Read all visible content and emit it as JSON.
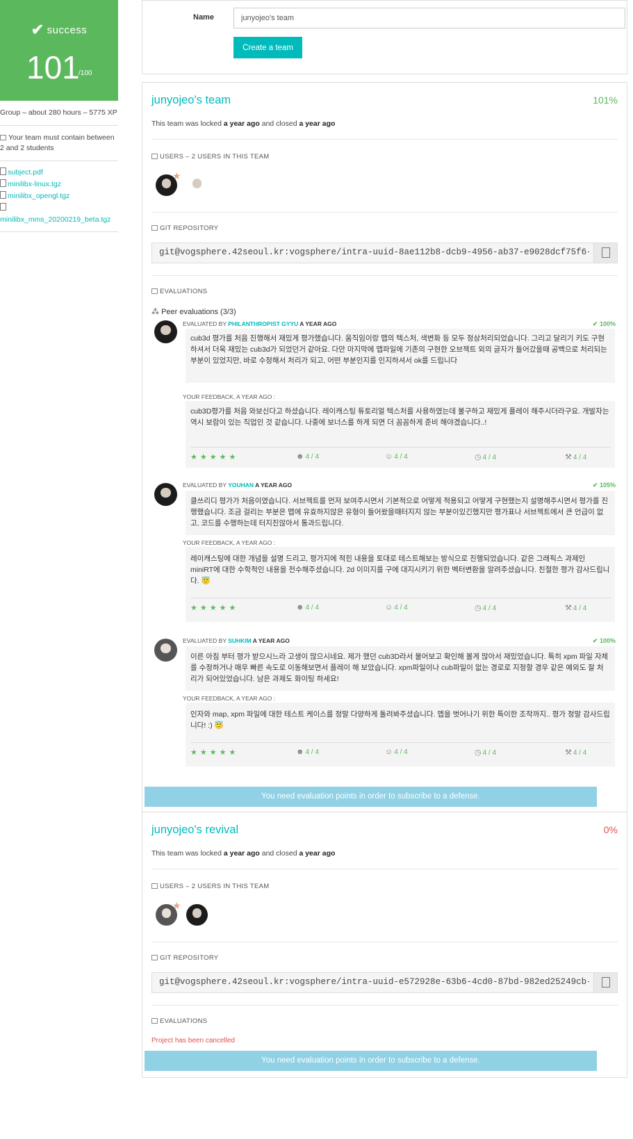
{
  "sidebar": {
    "status": "success",
    "score": "101",
    "score_max": "/100",
    "group_info": "Group – about 280 hours – 5775 XP",
    "team_rule": "Your team must contain between 2 and 2 students",
    "files": [
      "subject.pdf",
      "minilibx-linux.tgz",
      "minilibx_opengl.tgz",
      "minilibx_mms_20200219_beta.tgz"
    ]
  },
  "form": {
    "label": "Name",
    "input_value": "junyojeo's team",
    "button": "Create a team"
  },
  "team1": {
    "name": "junyojeo's team",
    "pct": "101%",
    "lock_prefix": "This team was locked ",
    "lock_ago1": "a year ago",
    "lock_mid": " and closed ",
    "lock_ago2": "a year ago",
    "users_header": "USERS – 2 USERS IN THIS TEAM",
    "git_header": "GIT REPOSITORY",
    "git_url": "git@vogsphere.42seoul.kr:vogsphere/intra-uuid-8ae112b8-dcb9-4956-ab37-e9028dcf75f6-",
    "eval_header": "EVALUATIONS",
    "peer_title": "Peer evaluations (3/3)",
    "evaluations": [
      {
        "by_prefix": "EVALUATED BY ",
        "evaluator": "PHILANTHROPIST GYYU",
        "ago": " A YEAR AGO",
        "pct": "100%",
        "comment": "cub3d 평가를 처음 진행해서 재밌게 평가했습니다. 움직임이랑 맵의 텍스처, 색변화 등 모두 정상처리되었습니다. 그리고 달리기 키도 구현하셔서 더욱 재밌는 cub3d가 되었던거 같아요. 다만 마지막에 맵파일에 기존의 구현한 오브젝트 외의 글자가 들어갔을때 공백으로 처리되는 부분이 있었지만, 바로 수정해서 처리가 되고, 어떤 부분인지를 인지하셔서 ok를 드립니다",
        "feedback_label": "YOUR FEEDBACK, A YEAR AGO :",
        "feedback": "cub3D평가를 처음 와보신다고 하셨습니다. 레이캐스팅 튜토리얼 텍스처를 사용하였는데 불구하고 재밌게 플레이 해주시더라구요. 개발자는 역시 보람이 있는 직업인 것 같습니다. 나중에 보너스를 하게 되면 더 꼼꼼하게 준비 해야겠습니다..!",
        "ratings": [
          "4 / 4",
          "4 / 4",
          "4 / 4",
          "4 / 4"
        ]
      },
      {
        "by_prefix": "EVALUATED BY ",
        "evaluator": "YOUHAN",
        "ago": " A YEAR AGO",
        "pct": "105%",
        "comment": "클쓰리디 평가가 처음이였습니다. 서브젝트를 먼저 보여주시면서 기본적으로 어떻게 적용되고 어떻게 구현했는지 설명해주시면서 평가를 진행했습니다. 조금 걸리는 부분은 맵에 유효하지않은 유형이 들어왔을때터지지 않는 부분이있긴했지만 평가표나 서브젝트에서 큰 언급이 없고, 코드를 수행하는데 터지진않아서 통과드립니다.",
        "feedback_label": "YOUR FEEDBACK, A YEAR AGO :",
        "feedback": "레이캐스팅에 대한 개념을 설명 드리고, 평가지에 적힌 내용을 토대로 테스트해보는 방식으로 진행되었습니다. 같은 그래픽스 과제인 miniRT에 대한 수학적인 내용을 전수해주셨습니다. 2d 이미지를 구에 대지시키기 위한 벡터변환을 알려주셨습니다. 친절한 평가 감사드립니다. 😇",
        "ratings": [
          "4 / 4",
          "4 / 4",
          "4 / 4",
          "4 / 4"
        ]
      },
      {
        "by_prefix": "EVALUATED BY ",
        "evaluator": "SUHKIM",
        "ago": " A YEAR AGO",
        "pct": "100%",
        "comment": "이른 아침 부터 평가 받으시느라 고생이 많으시네요. 제가 했던 cub3D라서 물어보고 확인해 볼게 많아서 재밌었습니다. 특히 xpm 파일 자체를 수정하거나 매우 빠른 속도로 이동해보면서 플레이 해 보았습니다. xpm파일이나 cub파일이 없는 경로로 지정할 경우 같은 예외도 잘 처리가 되어있었습니다. 남은 과제도 화이팅 하세요!",
        "feedback_label": "YOUR FEEDBACK, A YEAR AGO :",
        "feedback": "인자와 map, xpm 파일에 대한 테스트 케이스를 정말 다양하게 돌려봐주셨습니다. 맵을 벗어나기 위한 특이한 조작까지.. 평가 정말 감사드립니다! :) 😇",
        "ratings": [
          "4 / 4",
          "4 / 4",
          "4 / 4",
          "4 / 4"
        ]
      }
    ],
    "subscribe": "You need evaluation points in order to subscribe to a defense."
  },
  "team2": {
    "name": "junyojeo's revival",
    "pct": "0%",
    "lock_prefix": "This team was locked ",
    "lock_ago1": "a year ago",
    "lock_mid": " and closed ",
    "lock_ago2": "a year ago",
    "users_header": "USERS – 2 USERS IN THIS TEAM",
    "git_header": "GIT REPOSITORY",
    "git_url": "git@vogsphere.42seoul.kr:vogsphere/intra-uuid-e572928e-63b6-4cd0-87bd-982ed25249cb-",
    "eval_header": "EVALUATIONS",
    "cancelled": "Project has been cancelled",
    "subscribe": "You need evaluation points in order to subscribe to a defense."
  },
  "colors": {
    "success": "#5cb85c",
    "accent": "#00babc",
    "danger": "#d9534f",
    "disabled_button": "#90d1e6"
  }
}
